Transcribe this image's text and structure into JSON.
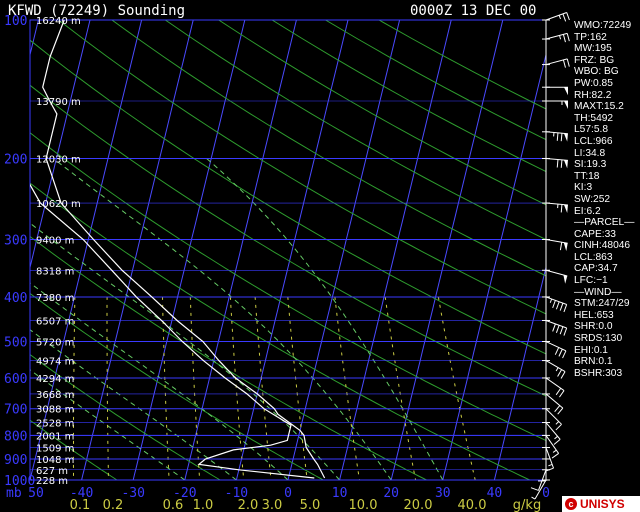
{
  "title": {
    "station": "KFWD (72249) Sounding",
    "time": "0000Z 13 DEC 00"
  },
  "indices": [
    "WMO:72249",
    "TP:162",
    "MW:195",
    "FRZ: BG",
    "WBO: BG",
    "PW:0.85",
    "RH:82.2",
    "MAXT:15.2",
    "TH:5492",
    "L57:5.8",
    "LCL:966",
    "LI:34.8",
    "SI:19.3",
    "TT:18",
    "KI:3",
    "SW:252",
    "EI:6.2",
    "—PARCEL—",
    "CAPE:33",
    "CINH:48046",
    "LCL:863",
    "CAP:34.7",
    "LFC:−1",
    "—WIND—",
    "STM:247/29",
    "HEL:653",
    "SHR:0.0",
    "SRDS:130",
    "EHI:0.1",
    "BRN:0.1",
    "BSHR:303"
  ],
  "logo": "UNISYS",
  "colors": {
    "background": "#000000",
    "isobar": "#3a3aff",
    "isotherm": "#4a4aff",
    "dry_adiabat": "#2e9c2e",
    "moist_adiabat": "#66cc66",
    "mixing_ratio": "#cccc44",
    "freezing_line": "#ffff33",
    "trace": "#ffffff",
    "wind_barb": "#ffffff"
  },
  "chart_data": {
    "type": "skew-t log-p",
    "x_axis": {
      "label": "mb",
      "temperature_ticks_c": [
        -50,
        -40,
        -30,
        -20,
        -10,
        0,
        10,
        20,
        30,
        40,
        50
      ],
      "temperature_tick_labels": [
        "50",
        "-40",
        "-30",
        "-20",
        "-10",
        "0",
        "10",
        "20",
        "30",
        "40",
        "0"
      ],
      "temperature_range_c": [
        -50,
        50
      ],
      "mixing_ratio_ticks_gkg": [
        0.1,
        0.2,
        0.6,
        1.0,
        2.0,
        3.0,
        5.0,
        10.0,
        20.0,
        40.0
      ],
      "mixing_ratio_tick_labels": [
        "0.1",
        "0.2",
        "0.6",
        "1.0",
        "2.0",
        "3.0",
        "5.0",
        "10.0",
        "20.0",
        "40.0"
      ],
      "mixing_ratio_unit": "g/kg"
    },
    "y_axis": {
      "scale": "log",
      "pressure_range_mb": [
        1000,
        100
      ],
      "pressure_tick_labels": [
        "100",
        "200",
        "300",
        "400",
        "500",
        "600",
        "700",
        "800",
        "900",
        "1000"
      ],
      "pressure_ticks_mb": [
        100,
        200,
        300,
        400,
        500,
        600,
        700,
        800,
        900,
        1000
      ]
    },
    "heights": [
      {
        "p": 100,
        "label": "16240 m"
      },
      {
        "p": 150,
        "label": "13790 m"
      },
      {
        "p": 200,
        "label": "12030 m"
      },
      {
        "p": 250,
        "label": "10620 m"
      },
      {
        "p": 300,
        "label": "9400 m"
      },
      {
        "p": 350,
        "label": "8318 m"
      },
      {
        "p": 400,
        "label": "7380 m"
      },
      {
        "p": 450,
        "label": "6507 m"
      },
      {
        "p": 500,
        "label": "5720 m"
      },
      {
        "p": 550,
        "label": "4974 m"
      },
      {
        "p": 600,
        "label": "4294 m"
      },
      {
        "p": 650,
        "label": "3668 m"
      },
      {
        "p": 700,
        "label": "3088 m"
      },
      {
        "p": 750,
        "label": "2528 m"
      },
      {
        "p": 800,
        "label": "2001 m"
      },
      {
        "p": 850,
        "label": "1509 m"
      },
      {
        "p": 900,
        "label": "1048 m"
      },
      {
        "p": 950,
        "label": "627 m"
      },
      {
        "p": 1000,
        "label": "228 m"
      }
    ],
    "temperature_profile": [
      [
        990,
        7
      ],
      [
        925,
        5
      ],
      [
        900,
        4
      ],
      [
        850,
        2
      ],
      [
        800,
        1
      ],
      [
        780,
        0
      ],
      [
        720,
        -5
      ],
      [
        700,
        -6
      ],
      [
        650,
        -10
      ],
      [
        600,
        -15
      ],
      [
        550,
        -19
      ],
      [
        500,
        -23
      ],
      [
        450,
        -29
      ],
      [
        400,
        -35
      ],
      [
        350,
        -42
      ],
      [
        300,
        -49
      ],
      [
        250,
        -57
      ],
      [
        200,
        -62
      ],
      [
        180,
        -62
      ],
      [
        160,
        -62
      ],
      [
        150,
        -64
      ],
      [
        140,
        -66
      ],
      [
        120,
        -66
      ],
      [
        100,
        -65
      ]
    ],
    "dewpoint_profile": [
      [
        990,
        5
      ],
      [
        950,
        -10
      ],
      [
        925,
        -18
      ],
      [
        900,
        -17
      ],
      [
        860,
        -12
      ],
      [
        840,
        -5
      ],
      [
        820,
        -2
      ],
      [
        800,
        -2
      ],
      [
        760,
        -2
      ],
      [
        700,
        -8
      ],
      [
        650,
        -12
      ],
      [
        600,
        -17
      ],
      [
        550,
        -22
      ],
      [
        500,
        -27
      ],
      [
        450,
        -32
      ],
      [
        400,
        -38
      ],
      [
        350,
        -44
      ],
      [
        300,
        -51
      ],
      [
        250,
        -61
      ],
      [
        200,
        -68
      ],
      [
        150,
        -72
      ],
      [
        100,
        -73
      ]
    ],
    "moist_adiabat_theta_e_k": [
      250,
      265,
      280,
      295,
      310,
      330,
      355,
      380
    ],
    "dry_adiabat_theta_k": [
      240,
      260,
      280,
      300,
      320,
      340,
      360,
      380,
      400,
      420,
      440,
      460,
      480,
      500,
      520
    ],
    "mixing_ratio_lines_gkg": [
      0.1,
      0.2,
      0.6,
      1.0,
      2.0,
      3.0,
      5.0,
      10.0,
      20.0,
      40.0
    ],
    "wind_barbs": [
      {
        "p": 100,
        "dir": 290,
        "spd": 25
      },
      {
        "p": 110,
        "dir": 285,
        "spd": 25
      },
      {
        "p": 125,
        "dir": 285,
        "spd": 20
      },
      {
        "p": 140,
        "dir": 270,
        "spd": 50
      },
      {
        "p": 150,
        "dir": 270,
        "spd": 55
      },
      {
        "p": 175,
        "dir": 265,
        "spd": 75
      },
      {
        "p": 200,
        "dir": 265,
        "spd": 70
      },
      {
        "p": 250,
        "dir": 265,
        "spd": 65
      },
      {
        "p": 300,
        "dir": 260,
        "spd": 60
      },
      {
        "p": 350,
        "dir": 255,
        "spd": 50
      },
      {
        "p": 400,
        "dir": 250,
        "spd": 45
      },
      {
        "p": 450,
        "dir": 250,
        "spd": 40
      },
      {
        "p": 500,
        "dir": 245,
        "spd": 30
      },
      {
        "p": 550,
        "dir": 240,
        "spd": 25
      },
      {
        "p": 600,
        "dir": 235,
        "spd": 20
      },
      {
        "p": 650,
        "dir": 230,
        "spd": 20
      },
      {
        "p": 700,
        "dir": 225,
        "spd": 15
      },
      {
        "p": 750,
        "dir": 220,
        "spd": 15
      },
      {
        "p": 800,
        "dir": 215,
        "spd": 15
      },
      {
        "p": 850,
        "dir": 200,
        "spd": 15
      },
      {
        "p": 900,
        "dir": 180,
        "spd": 10
      },
      {
        "p": 950,
        "dir": 160,
        "spd": 10
      },
      {
        "p": 1000,
        "dir": 150,
        "spd": 5
      }
    ]
  }
}
